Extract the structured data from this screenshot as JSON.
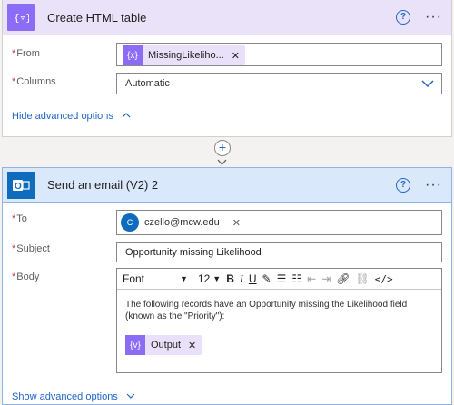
{
  "card1": {
    "title": "Create HTML table",
    "help": "?",
    "more": "···",
    "from_label": "From",
    "from_token": "MissingLikeliho...",
    "from_token_icon": "{x}",
    "columns_label": "Columns",
    "columns_value": "Automatic",
    "advanced_link": "Hide advanced options"
  },
  "card2": {
    "title": "Send an email (V2) 2",
    "help": "?",
    "more": "···",
    "to_label": "To",
    "to_avatar": "C",
    "to_value": "czello@mcw.edu",
    "subject_label": "Subject",
    "subject_value": "Opportunity missing Likelihood",
    "body_label": "Body",
    "font_name": "Font",
    "font_size": "12",
    "body_text": "The following records have an Opportunity missing the Likelihood field (known as the \"Priority\"):",
    "body_token": "Output",
    "body_token_icon": "{v}",
    "advanced_link": "Show advanced options"
  },
  "colors": {
    "accent": "#2266c8",
    "purple": "#8c6cf6",
    "outlook": "#0f6cbd"
  },
  "icons": [
    "table-icon",
    "help-icon",
    "more-icon",
    "remove-token-icon",
    "chevron-down-icon",
    "chevron-up-icon",
    "add-step-icon",
    "outlook-icon",
    "avatar",
    "bold-icon",
    "italic-icon",
    "underline-icon",
    "pen-icon",
    "bullet-list-icon",
    "numbered-list-icon",
    "outdent-icon",
    "indent-icon",
    "link-icon",
    "unlink-icon",
    "code-view-icon"
  ]
}
